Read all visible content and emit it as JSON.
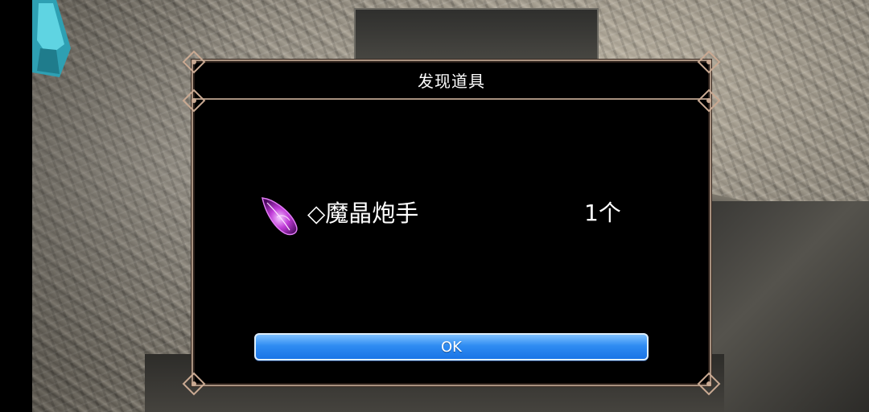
{
  "dialog": {
    "title": "发现道具",
    "item": {
      "icon": "purple-crystal-leaf-icon",
      "name": "◇魔晶炮手",
      "count": "1个"
    },
    "ok_label": "OK"
  },
  "colors": {
    "dialog_bg": "#000000",
    "border": "#a8917f",
    "button": "#2f8cf2",
    "item_icon": "#c03bd8",
    "crystal": "#3fb6c8"
  }
}
